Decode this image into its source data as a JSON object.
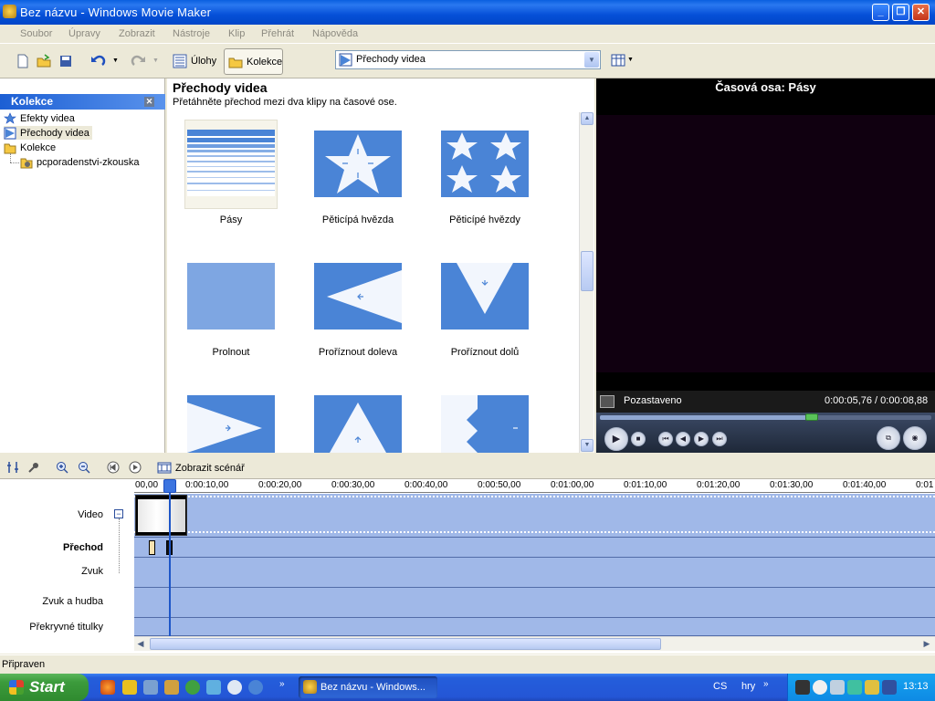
{
  "window": {
    "title": "Bez názvu - Windows Movie Maker"
  },
  "menu": [
    "Soubor",
    "Úpravy",
    "Zobrazit",
    "Nástroje",
    "Klip",
    "Přehrát",
    "Nápověda"
  ],
  "toolbar": {
    "tasks_label": "Úlohy",
    "collections_label": "Kolekce",
    "combo_value": "Přechody videa"
  },
  "collections_panel": {
    "title": "Kolekce",
    "items": [
      {
        "label": "Efekty videa"
      },
      {
        "label": "Přechody videa"
      },
      {
        "label": "Kolekce"
      },
      {
        "label": "pcporadenstvi-zkouska"
      }
    ]
  },
  "content": {
    "title": "Přechody videa",
    "subtitle": "Přetáhněte přechod mezi dva klipy na časové ose.",
    "items": [
      {
        "label": "Pásy",
        "icon": "bars-transition-icon"
      },
      {
        "label": "Pěticípá hvězda",
        "icon": "star-transition-icon"
      },
      {
        "label": "Pěticípé hvězdy",
        "icon": "stars-transition-icon"
      },
      {
        "label": "Prolnout",
        "icon": "fade-transition-icon"
      },
      {
        "label": "Proříznout doleva",
        "icon": "cut-left-transition-icon"
      },
      {
        "label": "Proříznout dolů",
        "icon": "cut-down-transition-icon"
      },
      {
        "label": "",
        "icon": "cut-right-transition-icon"
      },
      {
        "label": "",
        "icon": "cut-up-transition-icon"
      },
      {
        "label": "",
        "icon": "zigzag-transition-icon"
      }
    ]
  },
  "preview": {
    "title": "Časová osa: Pásy",
    "status": "Pozastaveno",
    "time": "0:00:05,76 / 0:00:08,88",
    "progress": 0.64
  },
  "timeline_toolbar": {
    "storyboard_label": "Zobrazit scénář"
  },
  "timeline": {
    "ticks": [
      "00,00",
      "0:00:10,00",
      "0:00:20,00",
      "0:00:30,00",
      "0:00:40,00",
      "0:00:50,00",
      "0:01:00,00",
      "0:01:10,00",
      "0:01:20,00",
      "0:01:30,00",
      "0:01:40,00",
      "0:01"
    ],
    "tracks": [
      "Video",
      "Přechod",
      "Zvuk",
      "Zvuk a hudba",
      "Překryvné titulky"
    ]
  },
  "status": {
    "text": "Připraven"
  },
  "taskbar": {
    "start_label": "Start",
    "task_label": "Bez názvu - Windows...",
    "language": "CS",
    "games_label": "hry",
    "clock": "13:13"
  },
  "colors": {
    "accent": "#0a5fe0",
    "track": "#a0b8e8",
    "transition_blue": "#4a84d6"
  }
}
